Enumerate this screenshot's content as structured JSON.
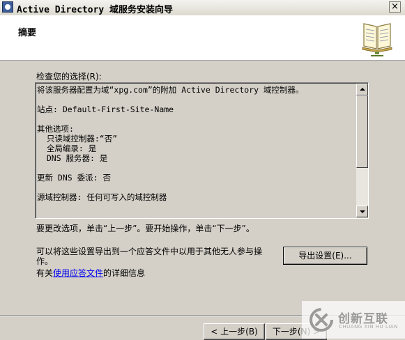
{
  "window": {
    "title": "Active Directory 域服务安装向导",
    "close_glyph": "×"
  },
  "header": {
    "title": "摘要",
    "icon": "book-icon"
  },
  "review": {
    "label": "检查您的选择(R):",
    "lines": [
      "将该服务器配置为域“xpg.com”的附加 Active Directory 域控制器。",
      "",
      "站点: Default-First-Site-Name",
      "",
      "其他选项:",
      "  只读域控制器:“否”",
      "  全局编录: 是",
      "  DNS 服务器: 是",
      "",
      "更新 DNS 委派: 否",
      "",
      "源域控制器: 任何可写入的域控制器"
    ]
  },
  "instruction": "要更改选项，单击“上一步”。要开始操作，单击“下一步”。",
  "export": {
    "description": "可以将这些设置导出到一个应答文件中以用于其他无人参与操作。",
    "button_label": "导出设置(E)..."
  },
  "details": {
    "prefix": "有关",
    "link_text": "使用应答文件",
    "suffix": "的详细信息"
  },
  "nav": {
    "back_label": "< 上一步(B)",
    "next_label": "下一步(N) >"
  },
  "watermark": {
    "text_cn": "创新互联",
    "text_en": "CHUANG XIN HU LIAN"
  }
}
